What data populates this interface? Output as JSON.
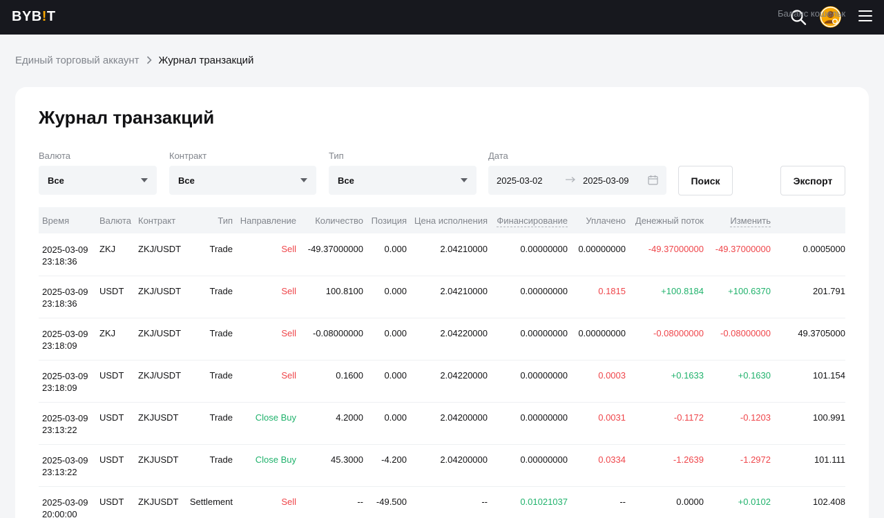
{
  "header": {
    "logo_text": "BYB",
    "logo_bang": "!",
    "logo_tail": "T"
  },
  "colors": {
    "brand": "#f7a600",
    "sell": "#ef454a",
    "buy": "#20b26c",
    "topbar": "#17181e"
  },
  "breadcrumb": {
    "parent": "Единый торговый аккаунт",
    "current": "Журнал транзакций"
  },
  "page": {
    "title": "Журнал транзакций"
  },
  "filters": {
    "currency": {
      "label": "Валюта",
      "value": "Все"
    },
    "contract": {
      "label": "Контракт",
      "value": "Все"
    },
    "type": {
      "label": "Тип",
      "value": "Все"
    },
    "date": {
      "label": "Дата",
      "from": "2025-03-02",
      "to": "2025-03-09"
    },
    "search_label": "Поиск",
    "export_label": "Экспорт"
  },
  "table": {
    "columns": {
      "time": "Время",
      "currency": "Валюта",
      "contract": "Контракт",
      "type": "Тип",
      "direction": "Направление",
      "qty": "Количество",
      "position": "Позиция",
      "price": "Цена исполнения",
      "funding": "Финансирование",
      "paid": "Уплачено",
      "cashflow": "Денежный поток",
      "change": "Изменить",
      "balance": "Баланс кошелька"
    },
    "rows": [
      {
        "date": "2025-03-09",
        "time": "23:18:36",
        "currency": "ZKJ",
        "contract": "ZKJ/USDT",
        "type": "Trade",
        "direction": "Sell",
        "qty": "-49.37000000",
        "position": "0.000",
        "price": "2.04210000",
        "funding": "0.00000000",
        "paid": "0.00000000",
        "cashflow": "-49.37000000",
        "change": "-49.37000000",
        "balance": "0.0005000"
      },
      {
        "date": "2025-03-09",
        "time": "23:18:36",
        "currency": "USDT",
        "contract": "ZKJ/USDT",
        "type": "Trade",
        "direction": "Sell",
        "qty": "100.8100",
        "position": "0.000",
        "price": "2.04210000",
        "funding": "0.00000000",
        "paid": "0.1815",
        "cashflow": "+100.8184",
        "change": "+100.6370",
        "balance": "201.791"
      },
      {
        "date": "2025-03-09",
        "time": "23:18:09",
        "currency": "ZKJ",
        "contract": "ZKJ/USDT",
        "type": "Trade",
        "direction": "Sell",
        "qty": "-0.08000000",
        "position": "0.000",
        "price": "2.04220000",
        "funding": "0.00000000",
        "paid": "0.00000000",
        "cashflow": "-0.08000000",
        "change": "-0.08000000",
        "balance": "49.3705000"
      },
      {
        "date": "2025-03-09",
        "time": "23:18:09",
        "currency": "USDT",
        "contract": "ZKJ/USDT",
        "type": "Trade",
        "direction": "Sell",
        "qty": "0.1600",
        "position": "0.000",
        "price": "2.04220000",
        "funding": "0.00000000",
        "paid": "0.0003",
        "cashflow": "+0.1633",
        "change": "+0.1630",
        "balance": "101.154"
      },
      {
        "date": "2025-03-09",
        "time": "23:13:22",
        "currency": "USDT",
        "contract": "ZKJUSDT",
        "type": "Trade",
        "direction": "Close Buy",
        "qty": "4.2000",
        "position": "0.000",
        "price": "2.04200000",
        "funding": "0.00000000",
        "paid": "0.0031",
        "cashflow": "-0.1172",
        "change": "-0.1203",
        "balance": "100.991"
      },
      {
        "date": "2025-03-09",
        "time": "23:13:22",
        "currency": "USDT",
        "contract": "ZKJUSDT",
        "type": "Trade",
        "direction": "Close Buy",
        "qty": "45.3000",
        "position": "-4.200",
        "price": "2.04200000",
        "funding": "0.00000000",
        "paid": "0.0334",
        "cashflow": "-1.2639",
        "change": "-1.2972",
        "balance": "101.111"
      },
      {
        "date": "2025-03-09",
        "time": "20:00:00",
        "currency": "USDT",
        "contract": "ZKJUSDT",
        "type": "Settlement",
        "direction": "Sell",
        "qty": "--",
        "position": "-49.500",
        "price": "--",
        "funding": "0.01021037",
        "paid": "--",
        "cashflow": "0.0000",
        "change": "+0.0102",
        "balance": "102.408"
      }
    ]
  }
}
